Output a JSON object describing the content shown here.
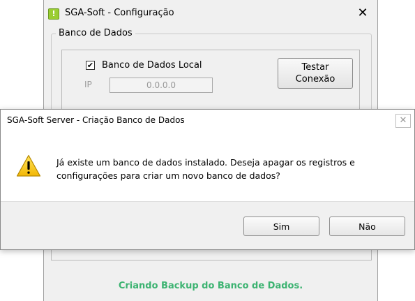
{
  "config_window": {
    "title": "SGA-Soft - Configuração",
    "close_glyph": "✕",
    "group_label": "Banco de Dados",
    "local_db_checkbox": {
      "label": "Banco de Dados Local",
      "checked": true
    },
    "ip_label": "IP",
    "ip_value": "0.0.0.0",
    "test_button_line1": "Testar",
    "test_button_line2": "Conexão",
    "status": "Criando Backup do Banco de Dados.",
    "status_color": "#3cb371"
  },
  "dialog": {
    "title": "SGA-Soft Server - Criação Banco de Dados",
    "close_glyph": "✕",
    "icon": "warning-icon",
    "message_line1": "Já existe um banco de dados instalado. Deseja apagar os registros e",
    "message_line2": "configurações para criar um novo banco de dados?",
    "buttons": {
      "yes": "Sim",
      "no": "Não"
    }
  }
}
